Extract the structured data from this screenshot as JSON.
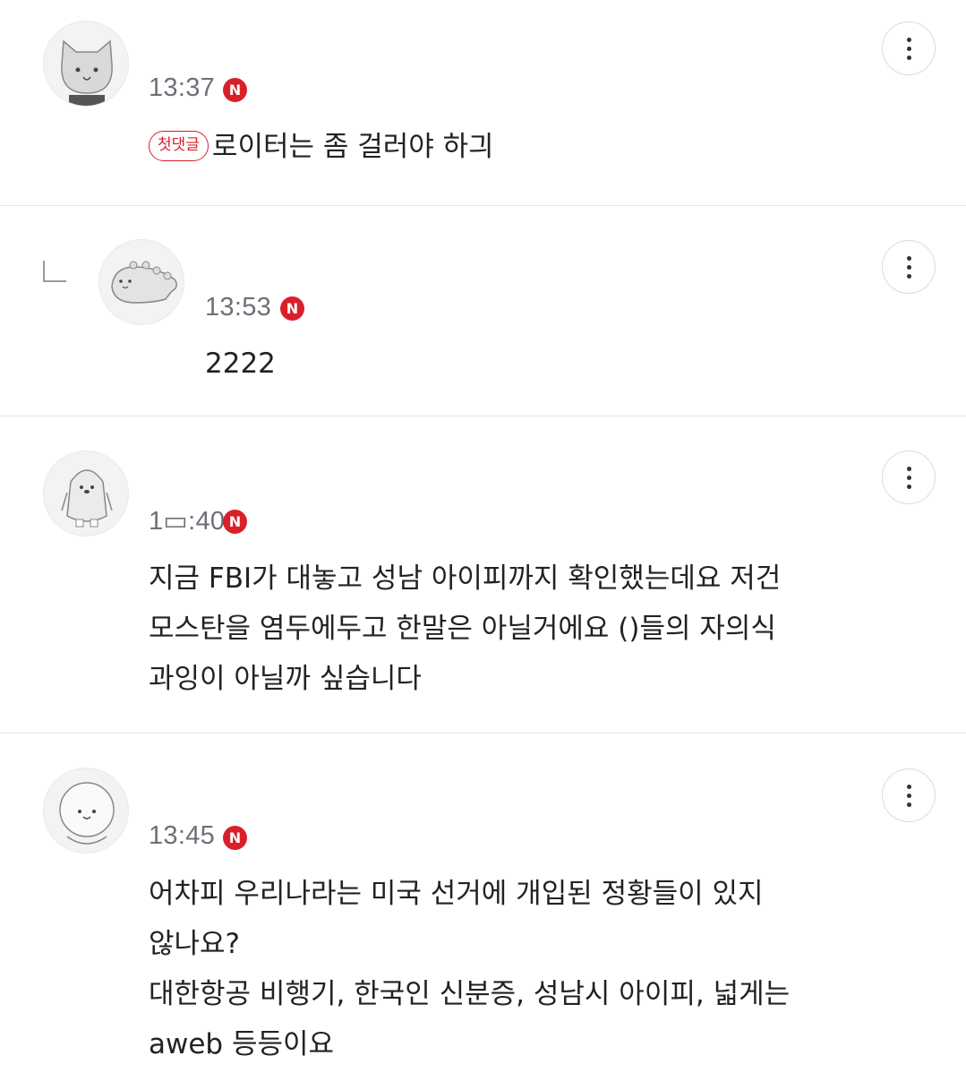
{
  "colors": {
    "accent": "#d9202a",
    "divider": "#e4e4e4",
    "time": "#6e7078",
    "text": "#222222"
  },
  "new_badge_label": "N",
  "comments": [
    {
      "time": "13:37",
      "first_badge": "첫댓글",
      "lines": [
        "로이터는 좀 걸러야 하긔"
      ],
      "avatar": "cat-avatar-icon"
    },
    {
      "time": "13:53",
      "lines": [
        "2222"
      ],
      "avatar": "dinosaur-avatar-icon",
      "is_reply": true
    },
    {
      "time": "1▭:40",
      "lines": [
        "지금 FBI가 대놓고 성남 아이피까지 확인했는데요 저건",
        "모스탄을 염두에두고 한말은 아닐거에요 ()들의 자의식",
        "과잉이 아닐까 싶습니다"
      ],
      "avatar": "penguin-avatar-icon"
    },
    {
      "time": "13:45",
      "lines": [
        "어차피 우리나라는 미국 선거에 개입된 정황들이 있지",
        "않나요?",
        "대한항공 비행기, 한국인 신분증, 성남시 아이피, 넓게는",
        "aweb 등등이요"
      ],
      "avatar": "bear-avatar-icon"
    }
  ]
}
